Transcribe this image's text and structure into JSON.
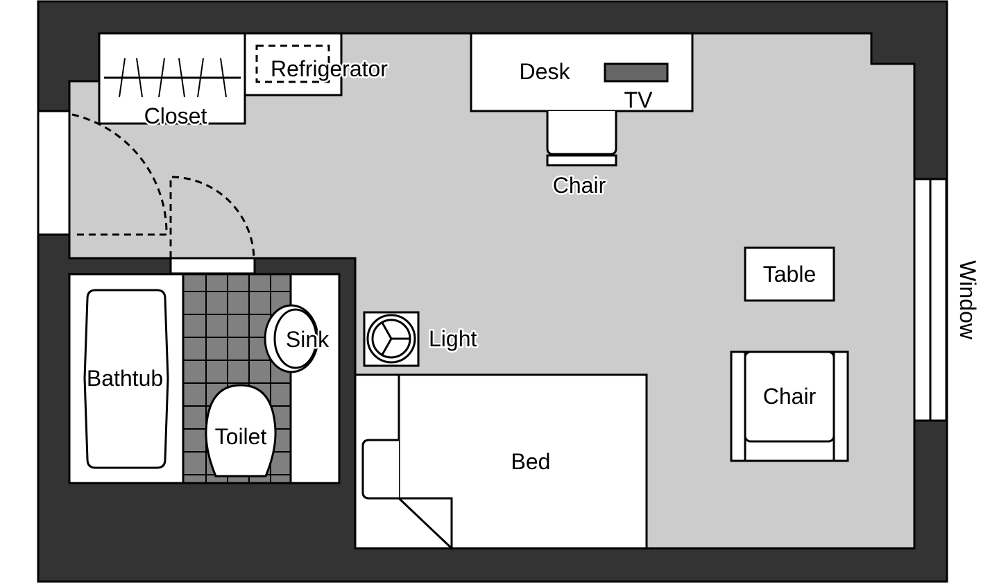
{
  "colors": {
    "wall": "#333333",
    "floor": "#cccccc",
    "fixture": "#ffffff",
    "tile": "#808080",
    "tv": "#666666"
  },
  "labels": {
    "closet": "Closet",
    "refrigerator": "Refrigerator",
    "desk": "Desk",
    "tv": "TV",
    "desk_chair": "Chair",
    "table": "Table",
    "armchair": "Chair",
    "window": "Window",
    "light": "Light",
    "bed": "Bed",
    "bathtub": "Bathtub",
    "sink": "Sink",
    "toilet": "Toilet"
  }
}
